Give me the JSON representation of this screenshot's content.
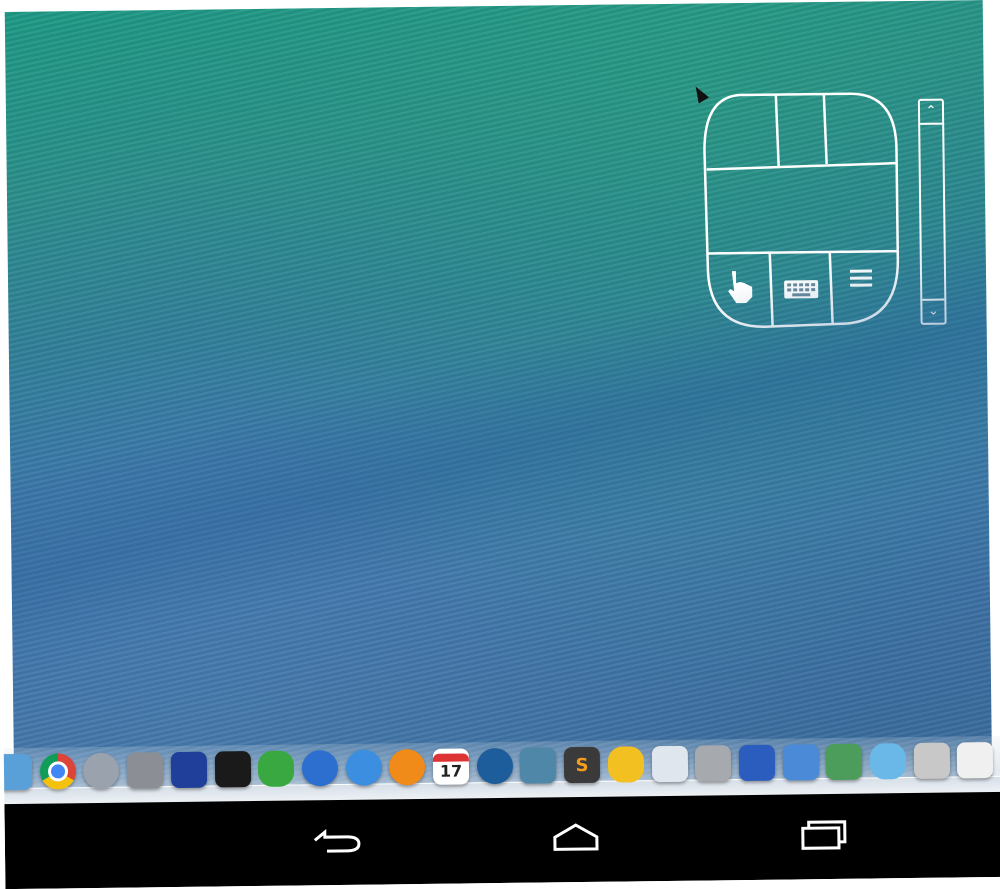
{
  "desktop": {
    "wallpaper": "ocean-wave"
  },
  "touchpad": {
    "buttons": [
      {
        "name": "touch-mode-button",
        "icon": "hand-pointer-icon"
      },
      {
        "name": "keyboard-button",
        "icon": "keyboard-icon"
      },
      {
        "name": "menu-button",
        "icon": "menu-icon"
      }
    ]
  },
  "scrollbar": {
    "up_glyph": "⌃",
    "down_glyph": "⌄"
  },
  "dock": {
    "icons": [
      {
        "name": "finder-partial-icon",
        "color": "#5aa0d8"
      },
      {
        "name": "chrome-icon",
        "color": "#e5e5e5"
      },
      {
        "name": "launchpad-icon",
        "color": "#9aa3ad"
      },
      {
        "name": "system-preferences-icon",
        "color": "#8b8f95"
      },
      {
        "name": "audacity-icon",
        "color": "#1f3f9a"
      },
      {
        "name": "terminal-icon",
        "color": "#1a1a1a"
      },
      {
        "name": "adium-icon",
        "color": "#3aa840"
      },
      {
        "name": "quicktime-icon",
        "color": "#2c6fcf"
      },
      {
        "name": "itunes-icon",
        "color": "#3c8ee0"
      },
      {
        "name": "ibooks-icon",
        "color": "#f08a18"
      },
      {
        "name": "calendar-icon",
        "color": "#ffffff",
        "day": "17"
      },
      {
        "name": "sourcetree-icon",
        "color": "#1e5d9c"
      },
      {
        "name": "jetbrains-icon",
        "color": "#4f87a8"
      },
      {
        "name": "sublime-text-icon",
        "color": "#3a3a3a"
      },
      {
        "name": "cyberduck-icon",
        "color": "#f2c020"
      },
      {
        "name": "preview-icon",
        "color": "#dfe6ee"
      },
      {
        "name": "calculator-icon",
        "color": "#a6a9ad"
      },
      {
        "name": "archive-utility-icon",
        "color": "#2a5dbd"
      },
      {
        "name": "xcode-icon",
        "color": "#4a8ad6"
      },
      {
        "name": "image-viewer-icon",
        "color": "#4c9c5c"
      },
      {
        "name": "wireshark-icon",
        "color": "#6ab8e8"
      },
      {
        "name": "console-icon",
        "color": "#c8c8c8"
      },
      {
        "name": "textedit-icon",
        "color": "#f0f0f0"
      }
    ],
    "calendar_day": "17",
    "sublime_letter": "S"
  },
  "navbar": {
    "buttons": [
      {
        "name": "back-button",
        "icon": "back-arrow-icon"
      },
      {
        "name": "home-button",
        "icon": "home-icon"
      },
      {
        "name": "recents-button",
        "icon": "recents-icon"
      }
    ]
  }
}
